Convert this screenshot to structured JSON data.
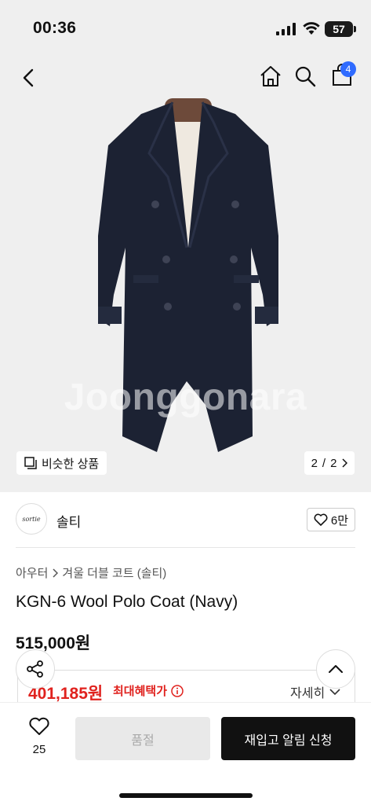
{
  "status_bar": {
    "time": "00:36",
    "battery": "57"
  },
  "header": {
    "cart_badge": "4"
  },
  "hero": {
    "watermark": "Joonggonara",
    "similar_label": "비슷한 상품",
    "pager": {
      "current": "2",
      "separator": "/",
      "total": "2"
    }
  },
  "seller": {
    "logo_text": "sortie",
    "name": "솔티",
    "likes": "6만"
  },
  "product": {
    "breadcrumb": [
      "아우터",
      "겨울 더블 코트 (솔티)"
    ],
    "title": "KGN-6 Wool Polo Coat (Navy)",
    "price": "515,000원",
    "benefit_price": "401,185원",
    "benefit_label": "최대혜택가",
    "detail_label": "자세히"
  },
  "bottom_bar": {
    "wish_count": "25",
    "soldout_label": "품절",
    "restock_label": "재입고 알림 신청"
  },
  "colors": {
    "accent_red": "#e0221e",
    "badge_blue": "#2f6bff",
    "coat_navy": "#1c2233"
  }
}
